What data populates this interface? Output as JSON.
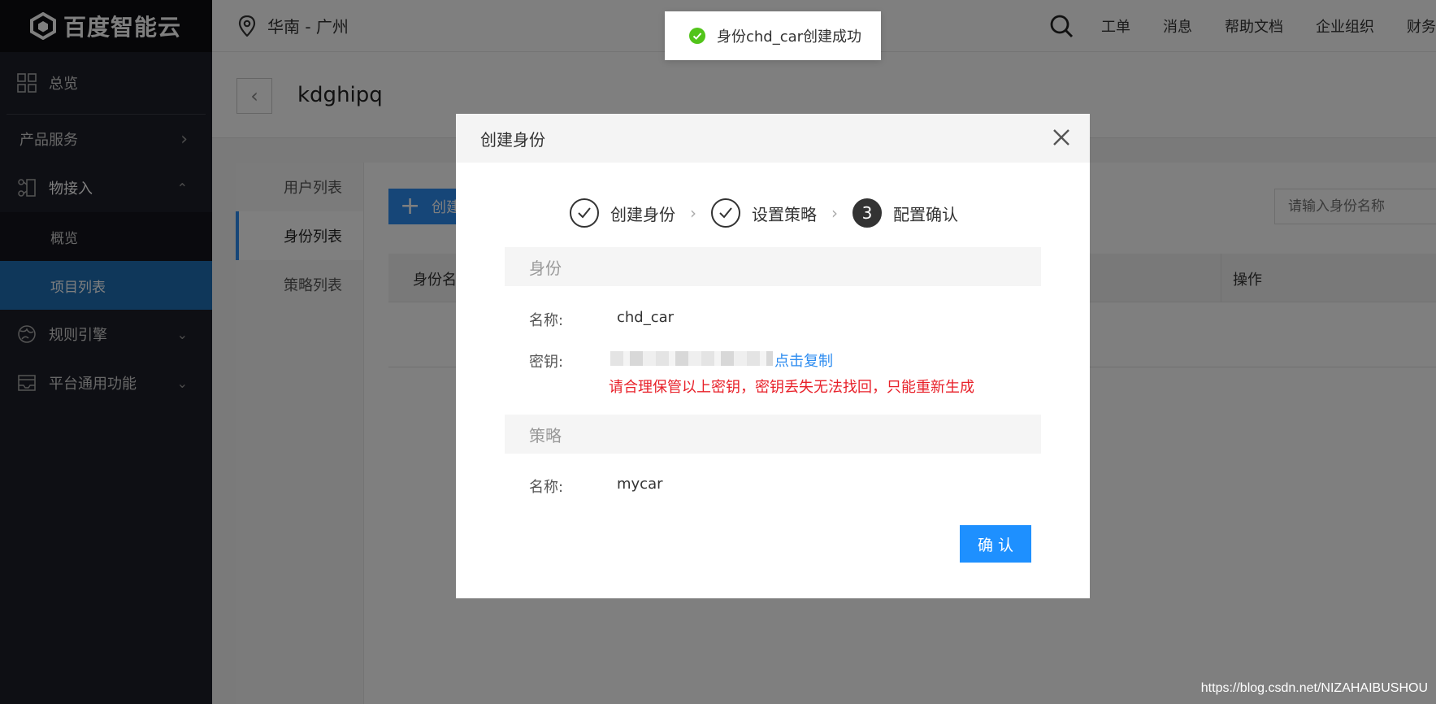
{
  "sidebar": {
    "logo": "百度智能云",
    "items": [
      {
        "label": "总览"
      },
      {
        "label": "产品服务"
      },
      {
        "label": "物接入"
      },
      {
        "label": "概览"
      },
      {
        "label": "项目列表"
      },
      {
        "label": "规则引擎"
      },
      {
        "label": "平台通用功能"
      }
    ]
  },
  "topbar": {
    "region": "华南 - 广州",
    "links": [
      "工单",
      "消息",
      "帮助文档",
      "企业组织",
      "财务"
    ]
  },
  "page": {
    "title": "kdghipq"
  },
  "tabs": [
    "用户列表",
    "身份列表",
    "策略列表"
  ],
  "toolbar": {
    "create_label": "创建",
    "search_placeholder": "请输入身份名称"
  },
  "table": {
    "col_name": "身份名",
    "col_action": "操作"
  },
  "toast": {
    "message": "身份chd_car创建成功"
  },
  "modal": {
    "title": "创建身份",
    "steps": [
      {
        "label": "创建身份",
        "state": "done"
      },
      {
        "label": "设置策略",
        "state": "done"
      },
      {
        "label": "配置确认",
        "state": "current",
        "number": "3"
      }
    ],
    "identity_section": "身份",
    "name_label": "名称:",
    "name_value": "chd_car",
    "key_label": "密钥:",
    "copy_label": "点击复制",
    "warning": "请合理保管以上密钥，密钥丢失无法找回，只能重新生成",
    "policy_section": "策略",
    "policy_name_label": "名称:",
    "policy_name_value": "mycar",
    "confirm_label": "确 认"
  },
  "watermark": "https://blog.csdn.net/NIZAHAIBUSHOU",
  "colors": {
    "primary": "#2d8cf0",
    "warning": "#e8212a",
    "success": "#52c41a",
    "sidebar_bg": "#1d1e28",
    "sidebar_active": "#1f6fb5"
  }
}
